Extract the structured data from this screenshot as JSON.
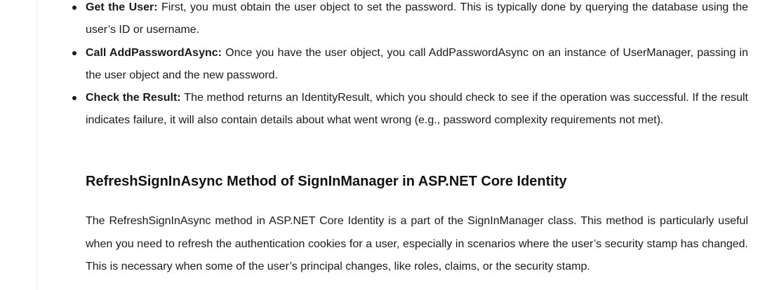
{
  "steps": [
    {
      "title": "Get the User:",
      "text": "First, you must obtain the user object to set the password. This is typically done by querying the database using the user’s ID or username."
    },
    {
      "title": "Call AddPasswordAsync:",
      "text": "Once you have the user object, you call AddPasswordAsync on an instance of UserManager, passing in the user object and the new password."
    },
    {
      "title": "Check the Result:",
      "text": "The method returns an IdentityResult, which you should check to see if the operation was successful. If the result indicates failure, it will also contain details about what went wrong (e.g., password complexity requirements not met)."
    }
  ],
  "section": {
    "heading": "RefreshSignInAsync Method of SignInManager in ASP.NET Core Identity",
    "paragraph": "The RefreshSignInAsync method in ASP.NET Core Identity is a part of the SignInManager class. This method is particularly useful when you need to refresh the authentication cookies for a user, especially in scenarios where the user’s security stamp has changed. This is necessary when some of the user’s principal changes, like roles, claims, or the security stamp."
  }
}
